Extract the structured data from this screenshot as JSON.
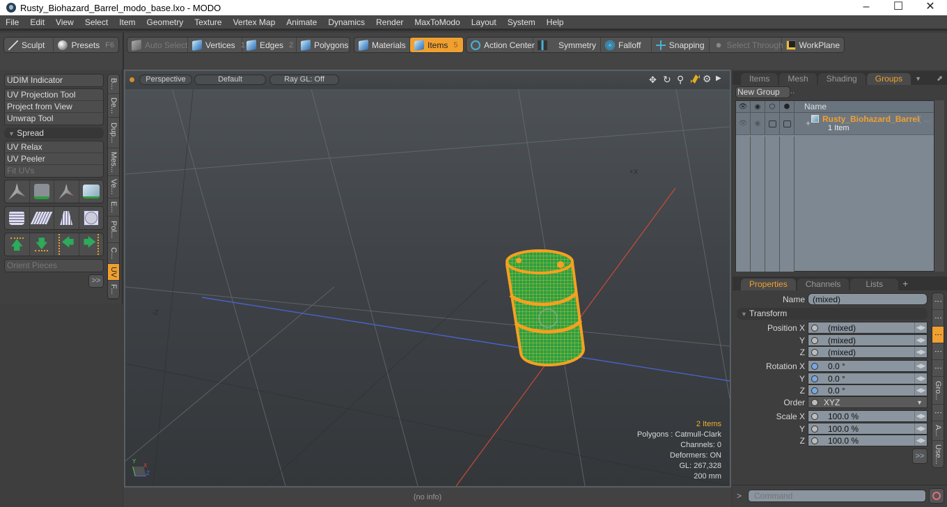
{
  "window": {
    "title": "Rusty_Biohazard_Barrel_modo_base.lxo - MODO",
    "minimize": "–",
    "maximize": "☐",
    "close": "✕"
  },
  "menu": [
    "File",
    "Edit",
    "View",
    "Select",
    "Item",
    "Geometry",
    "Texture",
    "Vertex Map",
    "Animate",
    "Dynamics",
    "Render",
    "MaxToModo",
    "Layout",
    "System",
    "Help"
  ],
  "toolbar": {
    "sculpt": "Sculpt",
    "presets": "Presets",
    "presets_key": "F6",
    "auto_select": "Auto Select",
    "vertices": "Vertices",
    "vertices_key": "1",
    "edges": "Edges",
    "edges_key": "2",
    "polygons": "Polygons",
    "materials": "Materials",
    "items": "Items",
    "items_key": "5",
    "action_center": "Action Center",
    "symmetry": "Symmetry",
    "falloff": "Falloff",
    "snapping": "Snapping",
    "select_through": "Select Through",
    "workplane": "WorkPlane"
  },
  "left_panel": {
    "udim": "UDIM Indicator",
    "tools1": [
      "UV Projection Tool",
      "Project from View",
      "Unwrap Tool"
    ],
    "spread_section": "Spread",
    "tools2": [
      "UV Relax",
      "UV Peeler",
      "Fit UVs"
    ],
    "orient": "Orient Pieces",
    "more": ">>",
    "vtabs": [
      "B...",
      "De...",
      "Dup...",
      "Mes...",
      "Ve...",
      "E...",
      "Pol...",
      "C...",
      "UV",
      "F..."
    ],
    "active_vtab": "UV"
  },
  "viewport": {
    "view": "Perspective",
    "shading": "Default",
    "raygl": "Ray GL: Off",
    "axis_plus_x": "+X",
    "axis_minus_z": "-Z",
    "info": {
      "items": "2 Items",
      "polygons": "Polygons : Catmull-Clark",
      "channels": "Channels: 0",
      "deformers": "Deformers: ON",
      "gl": "GL: 267,328",
      "scale": "200 mm"
    },
    "gizmo": {
      "x": "X",
      "y": "Y",
      "z": "Z"
    }
  },
  "status": "(no info)",
  "groups_panel": {
    "tabs": [
      "Items",
      "Mesh ...",
      "Shading",
      "Groups"
    ],
    "active_tab": "Groups",
    "new_group": "New Group",
    "col_name": "Name",
    "group_name": "Rusty_Biohazard_Barrel",
    "group_suffix": "( ...",
    "group_count": "1 Item"
  },
  "properties_panel": {
    "tabs": [
      "Properties",
      "Channels",
      "Lists"
    ],
    "active_tab": "Properties",
    "add": "+",
    "name_label": "Name",
    "name_value": "(mixed)",
    "transform_section": "Transform",
    "position": [
      {
        "label": "Position X",
        "value": "(mixed)"
      },
      {
        "label": "Y",
        "value": "(mixed)"
      },
      {
        "label": "Z",
        "value": "(mixed)"
      }
    ],
    "rotation": [
      {
        "label": "Rotation X",
        "value": "0.0 °"
      },
      {
        "label": "Y",
        "value": "0.0 °"
      },
      {
        "label": "Z",
        "value": "0.0 °"
      }
    ],
    "order_label": "Order",
    "order_value": "XYZ",
    "scale": [
      {
        "label": "Scale X",
        "value": "100.0 %"
      },
      {
        "label": "Y",
        "value": "100.0 %"
      },
      {
        "label": "Z",
        "value": "100.0 %"
      }
    ],
    "more": ">>",
    "vtabs": [
      "⋮",
      "⋮",
      "⋮",
      "⋮",
      "⋮",
      "Gro...",
      "⋮",
      "A...",
      "Use...",
      "⋮"
    ]
  },
  "command": {
    "prompt": ">",
    "placeholder": "Command"
  },
  "colors": {
    "accent": "#f0a030",
    "barrel_green": "#2ea52e",
    "axis_x": "#c84a3a",
    "axis_z": "#4a62c8"
  }
}
